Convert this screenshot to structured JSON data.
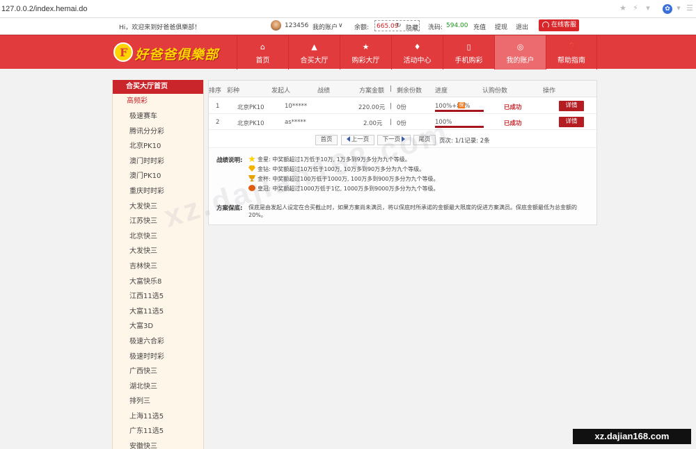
{
  "browser": {
    "url": "127.0.0.2/index.hemai.do",
    "profile_icon": "paw-icon"
  },
  "topbar": {
    "welcome": "Hi，欢迎来到好爸爸俱樂部！",
    "username": "123456",
    "my_account": "我的账户",
    "balance_label": "余额:",
    "balance_value": "665.09",
    "hide": "隐藏",
    "flow_label": "洗码:",
    "flow_value": "594.00",
    "recharge": "充值",
    "withdraw": "提现",
    "logout": "退出",
    "service": "在线客服"
  },
  "header": {
    "logo_text": "好爸爸俱樂部",
    "nav": [
      {
        "label": "首页",
        "icon": "home-icon"
      },
      {
        "label": "合买大厅",
        "icon": "warning-icon"
      },
      {
        "label": "购彩大厅",
        "icon": "star-icon"
      },
      {
        "label": "活动中心",
        "icon": "bag-icon"
      },
      {
        "label": "手机购彩",
        "icon": "phone-icon"
      },
      {
        "label": "我的账户",
        "icon": "user-icon"
      },
      {
        "label": "帮助指南",
        "icon": "help-icon"
      }
    ],
    "active_index": 5
  },
  "sidebar": {
    "head": "合买大厅首页",
    "category": "高频彩",
    "games": [
      "极速赛车",
      "腾讯分分彩",
      "北京PK10",
      "澳门时时彩",
      "澳门PK10",
      "重庆时时彩",
      "大发快三",
      "江苏快三",
      "北京快三",
      "大发快三",
      "吉林快三",
      "大富快乐8",
      "江西11选5",
      "大富11选5",
      "大富3D",
      "极速六合彩",
      "极速时时彩",
      "广西快三",
      "湖北快三",
      "排列三",
      "上海11选5",
      "广东11选5",
      "安徽快三"
    ]
  },
  "table": {
    "headers": [
      "排序",
      "彩种",
      "发起人",
      "战绩",
      "方案金额",
      "|",
      "剩余份数",
      "进度",
      "认购份数",
      "操作"
    ],
    "rows": [
      {
        "rank": "1",
        "game": "北京PK10",
        "initiator": "10*****",
        "amount": "220.00元",
        "sep": "|",
        "remaining": "0份",
        "progress": "100%+86%",
        "bao": "保",
        "status": "已成功",
        "detail": "详情"
      },
      {
        "rank": "2",
        "game": "北京PK10",
        "initiator": "as*****",
        "amount": "2.00元",
        "sep": "|",
        "remaining": "0份",
        "progress": "100%",
        "bao": "",
        "status": "已成功",
        "detail": "详情"
      }
    ]
  },
  "pager": {
    "first": "首页",
    "prev": "上一页",
    "next": "下一页",
    "last": "尾页",
    "info": "页次: 1/1记录: 2条"
  },
  "info": {
    "record_label": "战绩说明:",
    "levels": [
      {
        "icon": "star-icon",
        "text": "金星: 中奖额超过1万低于10万, 1万多到9万多分为九个等级。"
      },
      {
        "icon": "diamond-icon",
        "text": "金钻: 中奖额超过10万低于100万, 10万多到90万多分为九个等级。"
      },
      {
        "icon": "cup-icon",
        "text": "金杯: 中奖额超过100万低于1000万, 100万多到900万多分为九个等级。"
      },
      {
        "icon": "crown-icon",
        "text": "皇冠: 中奖额超过1000万低于1亿, 1000万多到9000万多分为九个等级。"
      }
    ],
    "guarantee_label": "方案保底:",
    "guarantee_text": "保底是由发起人设定在合买截止时，如果方案尚未满员，将以保底时所承诺的金额最大限度的促进方案满员。保底金额最低为总金额的20%。"
  },
  "watermark": "xz.dajian168.com"
}
